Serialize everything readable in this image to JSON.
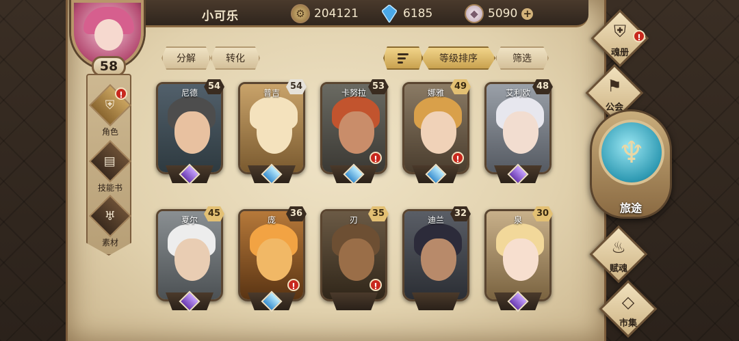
{
  "player": {
    "name": "小可乐",
    "level": "58"
  },
  "resources": {
    "gold": "204121",
    "crystal": "6185",
    "gem": "5090",
    "add": "+"
  },
  "tabs": {
    "decompose": "分解",
    "convert": "转化",
    "sort_level": "等级排序",
    "filter": "筛选"
  },
  "sidebar": {
    "items": [
      {
        "label": "角色",
        "icon": "helmet-icon",
        "glyph": "⛨",
        "badge": "!"
      },
      {
        "label": "技能书",
        "icon": "book-icon",
        "glyph": "▤"
      },
      {
        "label": "素材",
        "icon": "horns-icon",
        "glyph": "♅"
      }
    ]
  },
  "heroes": [
    {
      "name": "尼德",
      "level": "54",
      "rank": "purple",
      "warn": false
    },
    {
      "name": "普吉",
      "level": "54",
      "rank": "blue",
      "warn": false
    },
    {
      "name": "卡努拉",
      "level": "53",
      "rank": "blue",
      "warn": true
    },
    {
      "name": "娜雅",
      "level": "49",
      "rank": "blue",
      "warn": true
    },
    {
      "name": "艾利欧",
      "level": "48",
      "rank": "purple",
      "warn": false
    },
    {
      "name": "夏尔",
      "level": "45",
      "rank": "purple",
      "warn": false
    },
    {
      "name": "庞",
      "level": "36",
      "rank": "blue",
      "warn": true
    },
    {
      "name": "刃",
      "level": "35",
      "rank": "none",
      "warn": true
    },
    {
      "name": "迪兰",
      "level": "32",
      "rank": "none",
      "warn": false
    },
    {
      "name": "泉",
      "level": "30",
      "rank": "purple",
      "warn": false
    }
  ],
  "right_menu": {
    "soul_book": {
      "label": "魂册",
      "badge": "!"
    },
    "guild": {
      "label": "公会"
    },
    "journey": {
      "label": "旅途"
    },
    "endow_soul": {
      "label": "赋魂"
    },
    "market": {
      "label": "市集"
    }
  },
  "colors": {
    "accent_gold": "#c9a24f",
    "warn_red": "#c8281e",
    "rank_purple": "#6a3ab0",
    "rank_blue": "#3a8fd0"
  }
}
